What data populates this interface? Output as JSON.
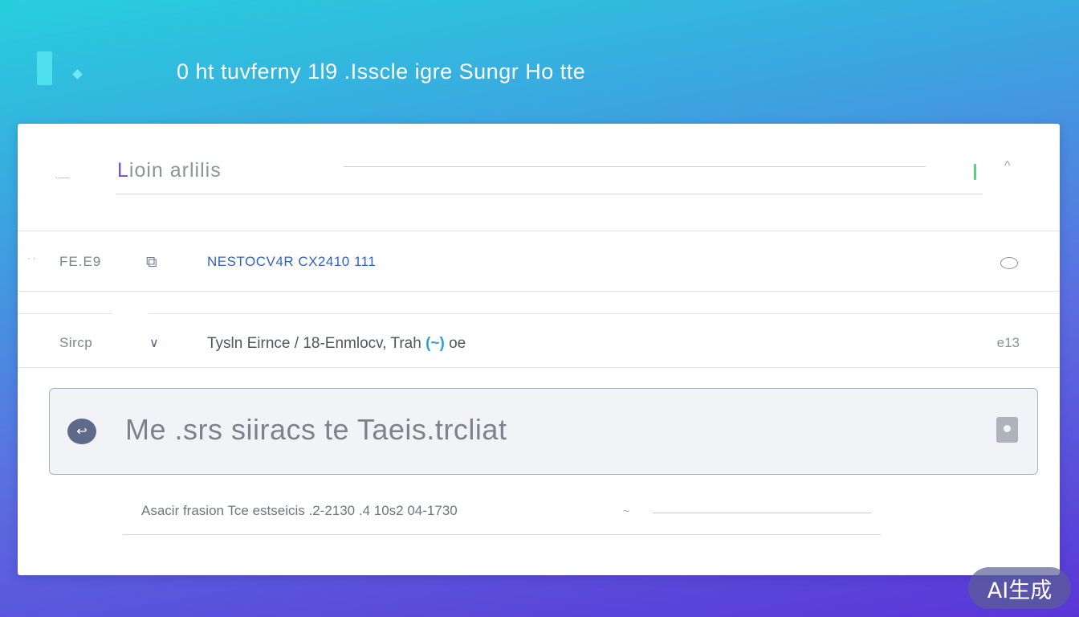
{
  "header": {
    "title": "0 ht tuvferny 1l9 .Isscle igre Sungr Ho tte"
  },
  "panel": {
    "title_first_char": "L",
    "title_rest": "ioin arlilis"
  },
  "rows": [
    {
      "label": "FE.E9",
      "icon": "copy-icon",
      "value": "NESTOCV4R CX2410 111"
    },
    {
      "label": "Sircp",
      "icon": "chevron-down-icon",
      "value_before": "Tysln Eirnce / 18-Enmlocv, Trah ",
      "value_highlight": "(~)",
      "value_after": " oe",
      "end_text": "e13"
    }
  ],
  "search": {
    "placeholder": "Me .srs siiracs te Taeis.trcliat"
  },
  "footer": {
    "meta": "Asacir frasion Tce estseicis .2-2130 .4 10s2 04-1730"
  },
  "badge": {
    "label": "AI生成"
  },
  "colors": {
    "accent": "#4fe0ee",
    "link": "#2f64c4",
    "status_green": "#5dd07e"
  }
}
